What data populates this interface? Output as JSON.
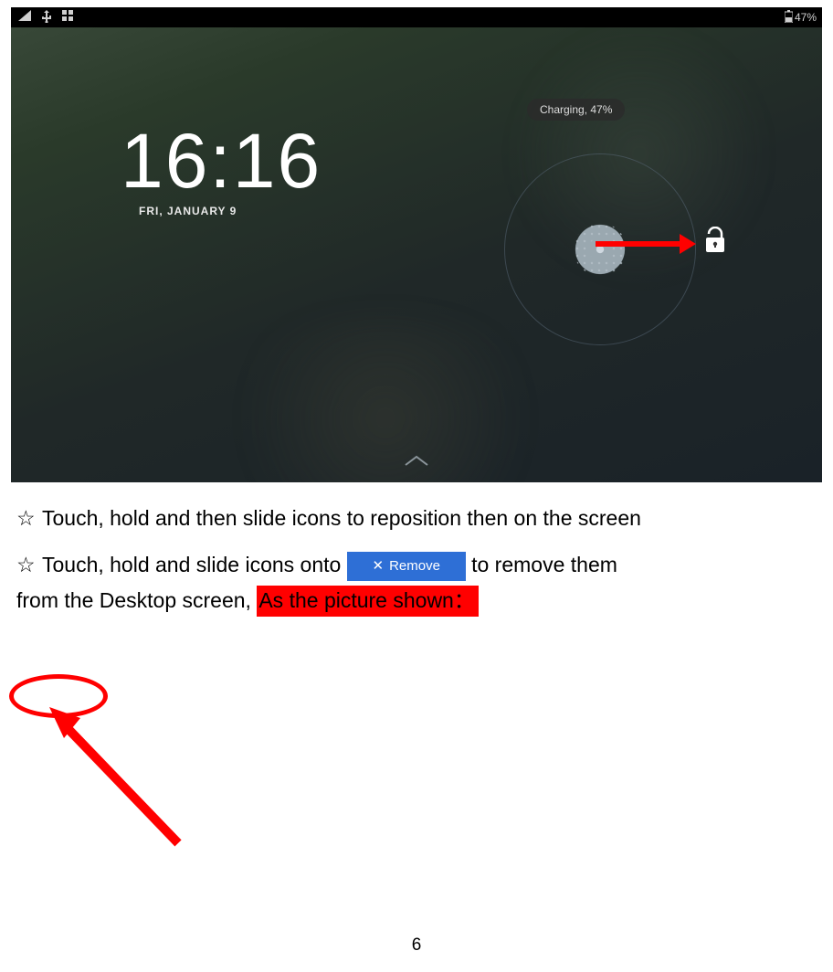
{
  "screenshot": {
    "status": {
      "battery_text": "47%"
    },
    "clock": {
      "time": "16:16",
      "date": "FRI, JANUARY 9"
    },
    "toast": "Charging, 47%"
  },
  "doc": {
    "bullet1": "Touch, hold and then slide icons to reposition then on the screen",
    "bullet2_a": "Touch, hold and slide icons onto",
    "remove_label": "Remove",
    "bullet2_b": "to remove them",
    "bullet2_c": "from the Desktop screen,",
    "highlight_text": "As the picture shown：",
    "star": "☆"
  },
  "page_number": "6"
}
